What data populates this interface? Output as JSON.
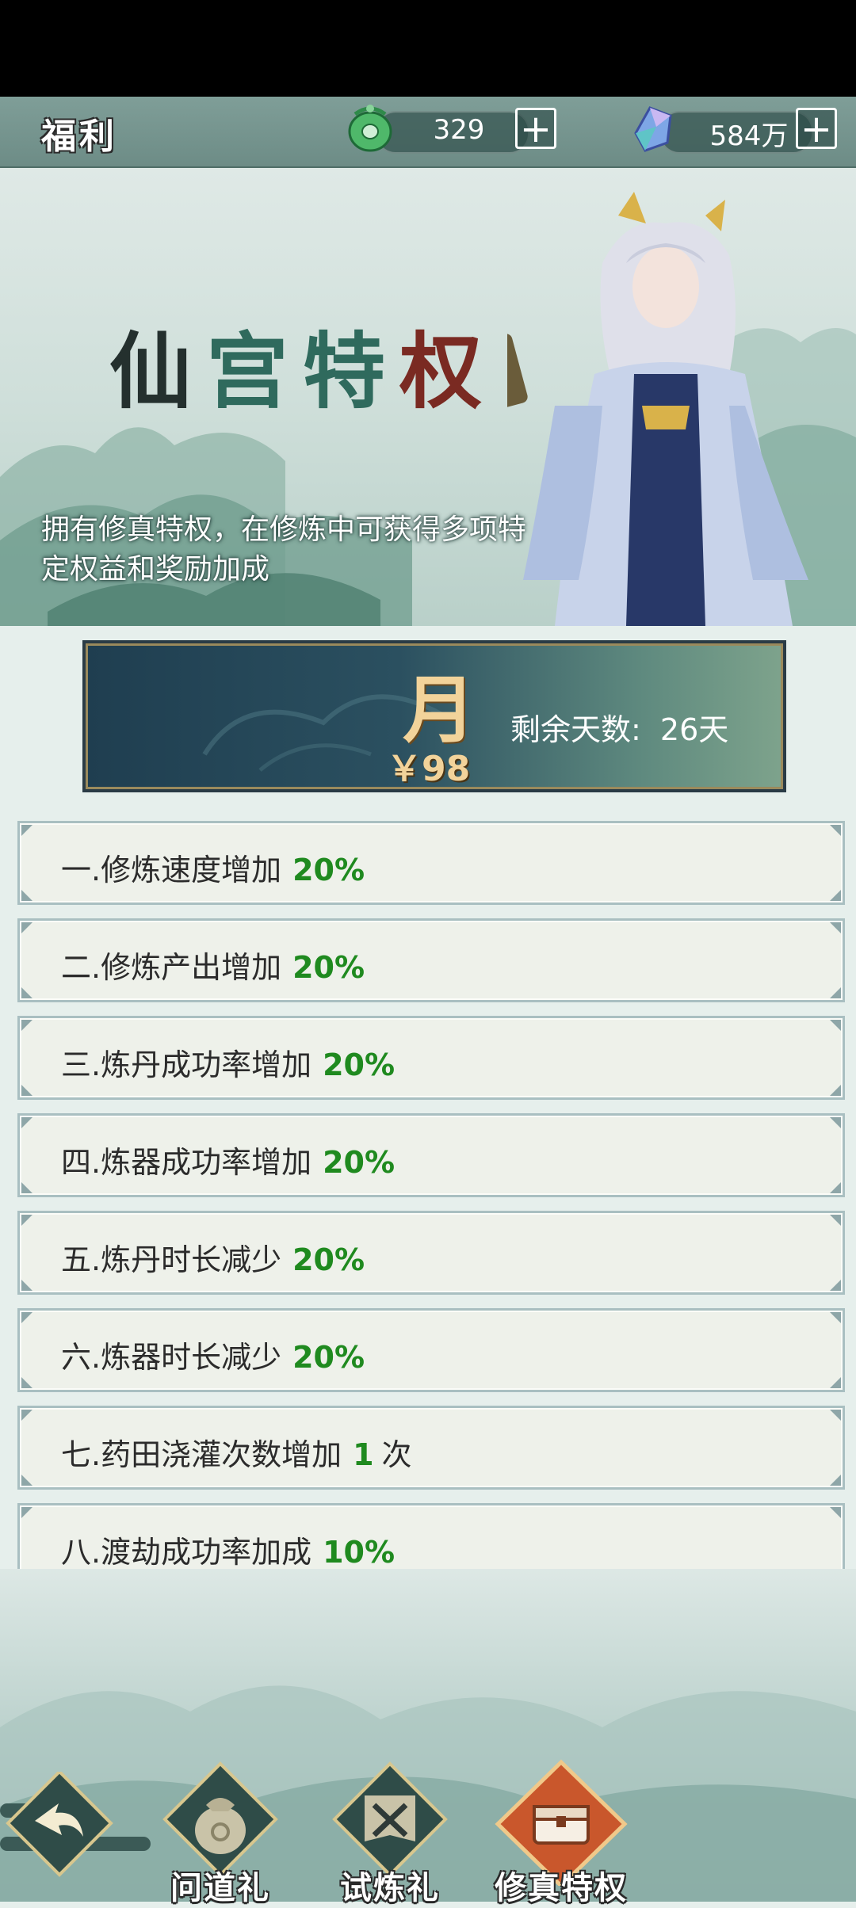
{
  "header": {
    "title": "福利",
    "jade": {
      "value": "329",
      "icon": "jade-coin-icon"
    },
    "crystal": {
      "value": "584万",
      "icon": "spirit-crystal-icon"
    }
  },
  "banner": {
    "title_chars": [
      "仙",
      "宫",
      "特",
      "权"
    ],
    "description": "拥有修真特权，在修炼中可获得多项特定权益和奖励加成"
  },
  "month_card": {
    "name": "月",
    "price": "￥98",
    "remaining_label": "剩余天数:",
    "remaining_value": "26天"
  },
  "privileges": [
    {
      "text": "一.修炼速度增加",
      "value": "20%",
      "unit": ""
    },
    {
      "text": "二.修炼产出增加",
      "value": "20%",
      "unit": ""
    },
    {
      "text": "三.炼丹成功率增加",
      "value": "20%",
      "unit": ""
    },
    {
      "text": "四.炼器成功率增加",
      "value": "20%",
      "unit": ""
    },
    {
      "text": "五.炼丹时长减少",
      "value": "20%",
      "unit": ""
    },
    {
      "text": "六.炼器时长减少",
      "value": "20%",
      "unit": ""
    },
    {
      "text": "七.药田浇灌次数增加",
      "value": "1",
      "unit": "次"
    },
    {
      "text": "八.渡劫成功率加成",
      "value": "10%",
      "unit": ""
    }
  ],
  "nav": {
    "back_icon": "back-arrow-icon",
    "tabs": [
      {
        "label": "问道礼",
        "icon": "money-bag-icon"
      },
      {
        "label": "试炼礼",
        "icon": "crossed-swords-icon"
      },
      {
        "label": "修真特权",
        "icon": "treasure-chest-icon"
      }
    ]
  },
  "colors": {
    "value_green": "#1f8a1f",
    "active_tab": "#c9572c",
    "gold": "#f2d39a"
  }
}
